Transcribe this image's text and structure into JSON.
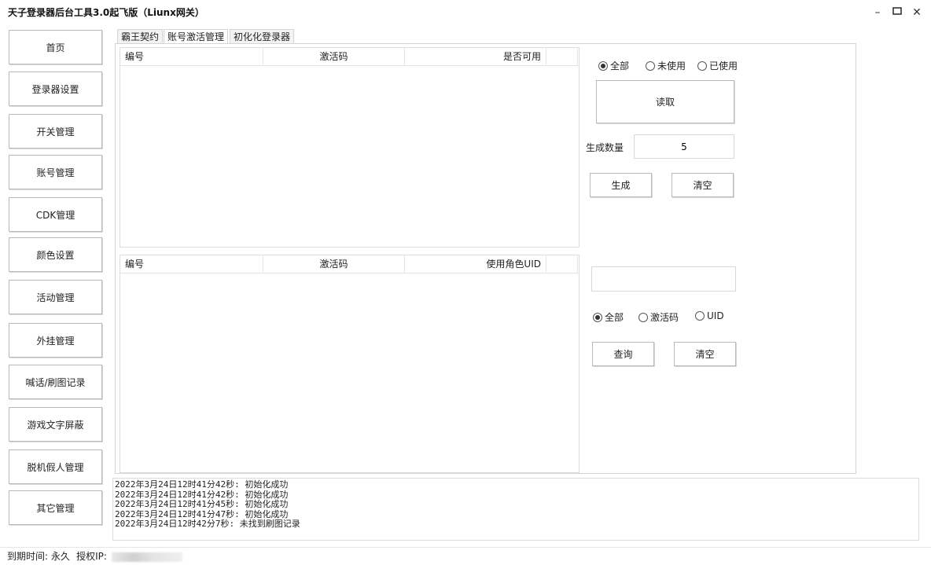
{
  "window": {
    "title": "天子登录器后台工具3.0起飞版（Liunx网关）",
    "minimize_glyph": "–",
    "maximize_glyph": "▭",
    "close_glyph": "✕"
  },
  "sidebar": {
    "items": [
      {
        "label": "首页"
      },
      {
        "label": "登录器设置"
      },
      {
        "label": "开关管理"
      },
      {
        "label": "账号管理"
      },
      {
        "label": "CDK管理"
      },
      {
        "label": "颜色设置"
      },
      {
        "label": "活动管理"
      },
      {
        "label": "外挂管理"
      },
      {
        "label": "喊话/刷图记录"
      },
      {
        "label": "游戏文字屏蔽"
      },
      {
        "label": "脱机假人管理"
      },
      {
        "label": "其它管理"
      }
    ]
  },
  "tabs": [
    {
      "label": "霸王契约"
    },
    {
      "label": "账号激活管理"
    },
    {
      "label": "初化化登录器"
    }
  ],
  "activation_table": {
    "columns": [
      "编号",
      "激活码",
      "是否可用"
    ]
  },
  "usage_table": {
    "columns": [
      "编号",
      "激活码",
      "使用角色UID"
    ]
  },
  "filter_top": {
    "options": [
      "全部",
      "未使用",
      "已使用"
    ],
    "selected": "全部"
  },
  "read_button": "读取",
  "generate": {
    "label": "生成数量",
    "count": "5",
    "generate_button": "生成",
    "clear_button": "清空"
  },
  "query": {
    "input_value": "",
    "options": [
      "全部",
      "激活码",
      "UID"
    ],
    "selected": "全部",
    "query_button": "查询",
    "clear_button": "清空"
  },
  "log": {
    "lines": [
      "2022年3月24日12时41分42秒: 初始化成功",
      "2022年3月24日12时41分42秒: 初始化成功",
      "2022年3月24日12时41分45秒: 初始化成功",
      "2022年3月24日12时41分47秒: 初始化成功",
      "2022年3月24日12时42分7秒: 未找到刷图记录"
    ]
  },
  "status": {
    "expire_label": "到期时间:",
    "expire_value": "永久",
    "ip_label": "授权IP:"
  }
}
